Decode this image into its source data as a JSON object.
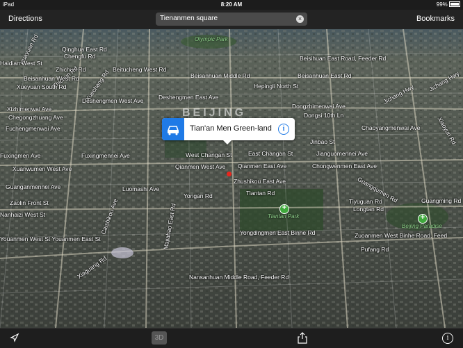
{
  "status_bar": {
    "device": "iPad",
    "time": "8:20 AM",
    "battery": "99%"
  },
  "nav": {
    "directions": "Directions",
    "bookmarks": "Bookmarks",
    "search_value": "Tienanmen square"
  },
  "map": {
    "city": "BEIJING",
    "parks": [
      "Olympic Park",
      "Tiantan Park",
      "Beijing Paradise"
    ],
    "roads": [
      "Qinghua East Rd",
      "Chengfu Rd",
      "Huayuan Rd",
      "Beisihuan East Road, Feeder Rd",
      "Haidian West St",
      "Zhichun Rd",
      "Beitucheng West Rd",
      "Beisanhuan West Rd",
      "Zhichun Rd",
      "Xueyuan South Rd",
      "Beisanhuan Middle Rd",
      "Beisanhuan East Rd",
      "Hepingli North St",
      "Xuechang Rd",
      "Deshengmen West Ave",
      "Deshengmen East Ave",
      "Jichang Hwy",
      "Jichang Hwy",
      "Xizhimenwai Ave",
      "Chegongzhuang Ave",
      "Dongzhimenwai Ave",
      "Dongsi 10th Ln",
      "Xiaoyun Rd",
      "Fuchengmenwai Ave",
      "Chaoyangmenwai Ave",
      "Jinbao St",
      "Fuxingmen Ave",
      "Fuxingmennei Ave",
      "West Changan St",
      "East Changan St",
      "Jianguomennei Ave",
      "Xuanwumen West Ave",
      "Qianmen West Ave",
      "Qianmen East Ave",
      "Chongwenmen East Ave",
      "Guanganmennei Ave",
      "Zhushikou East Ave",
      "Luomashi Ave",
      "Yongan Rd",
      "Tiantan Rd",
      "Guangqumen Rd",
      "Guangming Rd",
      "Zaolin Front St",
      "Nanhaizi West St",
      "Tiyuguan Rd",
      "Longtan Rd",
      "Youanmen West St Youanmen East St",
      "Yongdingmen East Binhe Rd",
      "Zuoanmen West Binhe Road, Feed",
      "Pufang Rd",
      "Nansanhuan Middle Road, Feeder Rd",
      "Caishikou Ave",
      "Majiabao East Rd",
      "Xiaguang Rd"
    ]
  },
  "callout": {
    "name": "Tian'an Men Green-land"
  },
  "toolbar": {
    "three_d": "3D"
  },
  "colors": {
    "accent": "#1f7ae6",
    "pin": "#e8261e",
    "park": "#3fa93c"
  }
}
